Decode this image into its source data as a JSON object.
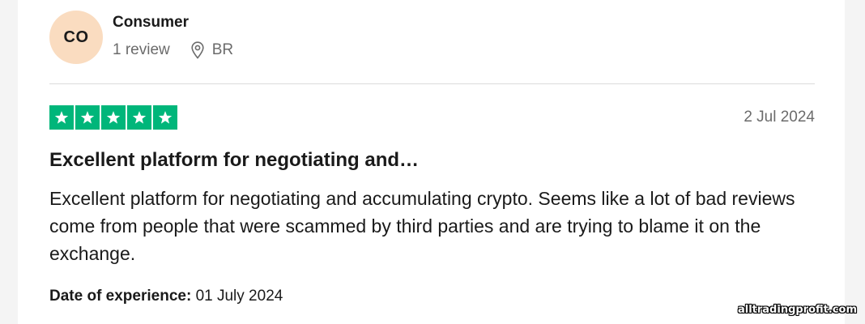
{
  "reviewer": {
    "initials": "CO",
    "name": "Consumer",
    "review_count": "1 review",
    "location": "BR"
  },
  "review": {
    "rating": 5,
    "rating_max": 5,
    "date": "2 Jul 2024",
    "title": "Excellent platform for negotiating and…",
    "body": "Excellent platform for negotiating and accumulating crypto. Seems like a lot of bad reviews come from people that were scammed by third parties and are trying to blame it on the exchange.",
    "experience_label": "Date of experience:",
    "experience_date": "01 July 2024"
  },
  "watermark": "alltradingprofit.com",
  "colors": {
    "star_fill": "#00b67a",
    "avatar_bg": "#fadcc0",
    "muted_text": "#6b6b6b"
  },
  "icons": {
    "location": "location-pin-icon",
    "star": "star-icon"
  }
}
